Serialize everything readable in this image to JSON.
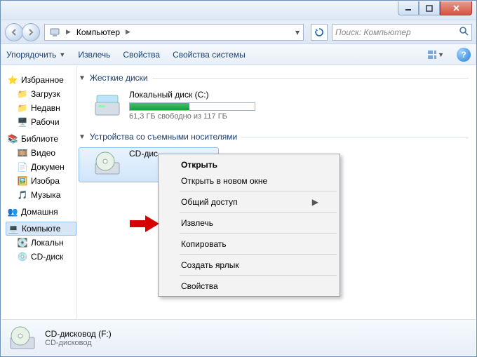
{
  "address": {
    "root_label": "Компьютер"
  },
  "search": {
    "placeholder": "Поиск: Компьютер"
  },
  "toolbar": {
    "organize": "Упорядочить",
    "eject": "Извлечь",
    "properties": "Свойства",
    "system_properties": "Свойства системы"
  },
  "sidebar": {
    "favorites": "Избранное",
    "downloads": "Загрузк",
    "recent": "Недавн",
    "desktop": "Рабочи",
    "libraries": "Библиоте",
    "video": "Видео",
    "documents": "Докумен",
    "pictures": "Изобра",
    "music": "Музыка",
    "homegroup": "Домашня",
    "computer": "Компьюте",
    "local_disk": "Локальн",
    "cd_drive": "CD-диск"
  },
  "groups": {
    "hdd": "Жесткие диски",
    "removable": "Устройства со съемными носителями"
  },
  "drives": {
    "local": {
      "name": "Локальный диск (C:)",
      "free_text": "61,3 ГБ свободно из 117 ГБ",
      "used_percent": 48
    },
    "cd": {
      "name": "CD-дис"
    }
  },
  "context_menu": {
    "open": "Открыть",
    "open_new_window": "Открыть в новом окне",
    "sharing": "Общий доступ",
    "eject": "Извлечь",
    "copy": "Копировать",
    "create_shortcut": "Создать ярлык",
    "properties": "Свойства"
  },
  "statusbar": {
    "title": "CD-дисковод (F:)",
    "subtitle": "CD-дисковод"
  }
}
